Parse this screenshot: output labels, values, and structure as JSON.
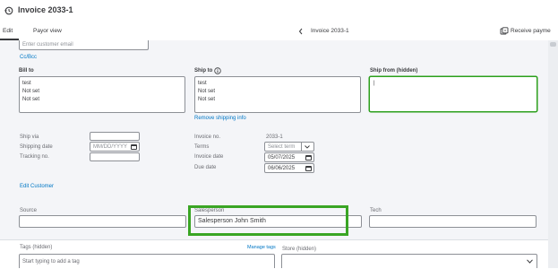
{
  "header": {
    "title": "Invoice 2033-1",
    "history_icon": "history-icon"
  },
  "tabs": [
    {
      "label": "Edit"
    },
    {
      "label": "Payor view"
    }
  ],
  "nav": {
    "current": "Invoice 2033-1",
    "receive_payment": "Receive payme"
  },
  "customer": {
    "email_placeholder": "Enter customer email",
    "ccbcc_link": "Cc/Bcc"
  },
  "bill_to": {
    "label": "Bill to",
    "lines": [
      "test",
      "Not set",
      "Not set"
    ]
  },
  "ship_to": {
    "label": "Ship to",
    "lines": [
      "test",
      "Not set",
      "Not set"
    ],
    "remove_link": "Remove shipping info"
  },
  "ship_from": {
    "label": "Ship from (hidden)",
    "value": "|"
  },
  "shipping": {
    "ship_via_label": "Ship via",
    "shipping_date_label": "Shipping date",
    "shipping_date_placeholder": "MM/DD/YYYY",
    "tracking_label": "Tracking no."
  },
  "invoice": {
    "no_label": "Invoice no.",
    "no_value": "2033-1",
    "terms_label": "Terms",
    "terms_placeholder": "Select term",
    "invoice_date_label": "Invoice date",
    "invoice_date_value": "05/07/2025",
    "due_date_label": "Due date",
    "due_date_value": "06/06/2025"
  },
  "edit_customer_link": "Edit Customer",
  "custom_fields": {
    "source_label": "Source",
    "source_value": "",
    "salesperson_label": "Salesperson",
    "salesperson_value": "Salesperson John Smith",
    "tech_label": "Tech",
    "tech_value": ""
  },
  "tags": {
    "label": "Tags (hidden)",
    "manage_link": "Manage tags",
    "placeholder": "Start typing to add a tag"
  },
  "store": {
    "label": "Store (hidden)",
    "value": ""
  },
  "colors": {
    "link": "#0077c5",
    "focus_green": "#2ca01c",
    "highlight_green": "#3aa524"
  }
}
